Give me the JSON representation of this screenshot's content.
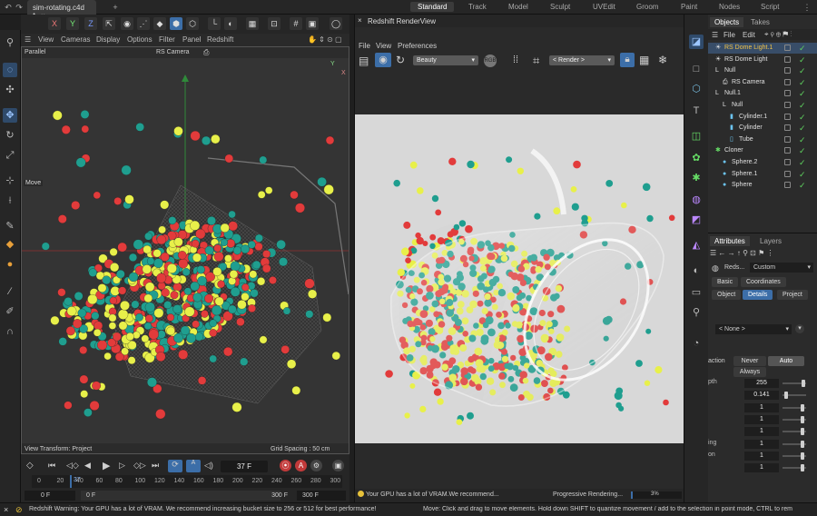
{
  "file_tab": "sim-rotating.c4d *",
  "layouts": [
    "Standard",
    "Track",
    "Model",
    "Sculpt",
    "UVEdit",
    "Groom",
    "Paint",
    "Nodes",
    "Script"
  ],
  "active_layout": "Standard",
  "axis_buttons": [
    "X",
    "Y",
    "Z"
  ],
  "viewport_menu": [
    "View",
    "Cameras",
    "Display",
    "Options",
    "Filter",
    "Panel",
    "Redshift"
  ],
  "viewport": {
    "projection": "Parallel",
    "camera": "RS Camera",
    "move_label": "Move",
    "view_transform": "View Transform: Project",
    "grid_spacing": "Grid Spacing : 50 cm"
  },
  "timeline": {
    "current_frame": "37 F",
    "ticks": [
      "0",
      "20",
      "40",
      "60",
      "80",
      "100",
      "120",
      "140",
      "160",
      "180",
      "200",
      "220",
      "240",
      "260",
      "280",
      "300"
    ],
    "playhead_label": "37",
    "start": "0 F",
    "min": "0 F",
    "max": "300 F",
    "end": "300 F"
  },
  "render_view": {
    "title": "Redshift RenderView",
    "menu": [
      "File",
      "View",
      "Preferences"
    ],
    "aov": "Beauty",
    "render_select": "< Render >",
    "status_msg": "Your GPU has a lot of VRAM.We recommend...",
    "progress_label": "Progressive Rendering...",
    "progress_pct": "3%",
    "progress_value": 0.03
  },
  "objects_panel": {
    "tabs": [
      "Objects",
      "Takes"
    ],
    "menu": [
      "File",
      "Edit"
    ],
    "items": [
      {
        "name": "RS Dome Light.1",
        "indent": 0,
        "icon": "light-icon",
        "hl": true,
        "color": "#f0c24a"
      },
      {
        "name": "RS Dome Light",
        "indent": 0,
        "icon": "light-icon",
        "hl": false,
        "color": "#e0e0e0"
      },
      {
        "name": "Null",
        "indent": 0,
        "icon": "null-icon",
        "hl": false,
        "color": "#e0e0e0"
      },
      {
        "name": "RS Camera",
        "indent": 1,
        "icon": "camera-icon",
        "hl": false,
        "color": "#e0e0e0"
      },
      {
        "name": "Null.1",
        "indent": 0,
        "icon": "null-icon",
        "hl": false,
        "color": "#e0e0e0"
      },
      {
        "name": "Null",
        "indent": 1,
        "icon": "null-icon",
        "hl": false,
        "color": "#e0e0e0"
      },
      {
        "name": "Cylinder.1",
        "indent": 2,
        "icon": "cylinder-icon",
        "hl": false,
        "color": "#e0e0e0"
      },
      {
        "name": "Cylinder",
        "indent": 2,
        "icon": "cylinder-icon",
        "hl": false,
        "color": "#e0e0e0"
      },
      {
        "name": "Tube",
        "indent": 2,
        "icon": "tube-icon",
        "hl": false,
        "color": "#e0e0e0"
      },
      {
        "name": "Cloner",
        "indent": 0,
        "icon": "cloner-icon",
        "hl": false,
        "color": "#e0e0e0"
      },
      {
        "name": "Sphere.2",
        "indent": 1,
        "icon": "sphere-icon",
        "hl": false,
        "color": "#e0e0e0"
      },
      {
        "name": "Sphere.1",
        "indent": 1,
        "icon": "sphere-icon",
        "hl": false,
        "color": "#e0e0e0"
      },
      {
        "name": "Sphere",
        "indent": 1,
        "icon": "sphere-icon",
        "hl": false,
        "color": "#e0e0e0"
      }
    ]
  },
  "attributes": {
    "tabs": [
      "Attributes",
      "Layers"
    ],
    "object_label": "Reds...",
    "preset": "Custom",
    "tabs_row1": [
      "Basic",
      "Coordinates"
    ],
    "tabs_row2": [
      "Object",
      "Details",
      "Project"
    ],
    "active_tab": "Details",
    "none_select": "< None >",
    "action_label": "action",
    "action_options": [
      "Never",
      "Auto",
      "Always"
    ],
    "action_selected": "Auto",
    "rows": [
      {
        "label": "pth",
        "value": "255",
        "level": 0.95
      },
      {
        "label": "",
        "value": "0.141",
        "level": 0.1
      },
      {
        "label": "",
        "value": "1",
        "level": 0.9
      },
      {
        "label": "",
        "value": "1",
        "level": 0.9
      },
      {
        "label": "",
        "value": "1",
        "level": 0.9
      },
      {
        "label": "ing",
        "value": "1",
        "level": 0.9
      },
      {
        "label": "on",
        "value": "1",
        "level": 0.9
      },
      {
        "label": "",
        "value": "1",
        "level": 0.9
      }
    ]
  },
  "status": {
    "left": "Redshift Warning: Your GPU has a lot of VRAM. We recommend increasing bucket size to 256 or 512 for best performance!",
    "right": "Move: Click and drag to move elements. Hold down SHIFT to quantize movement / add to the selection in point mode, CTRL to rem"
  },
  "colors": {
    "accent": "#3c6ea8",
    "ball_red": "#e23b3b",
    "ball_teal": "#1f9e8f",
    "ball_yellow": "#e8f04a",
    "highlight_name": "#f0c24a"
  }
}
